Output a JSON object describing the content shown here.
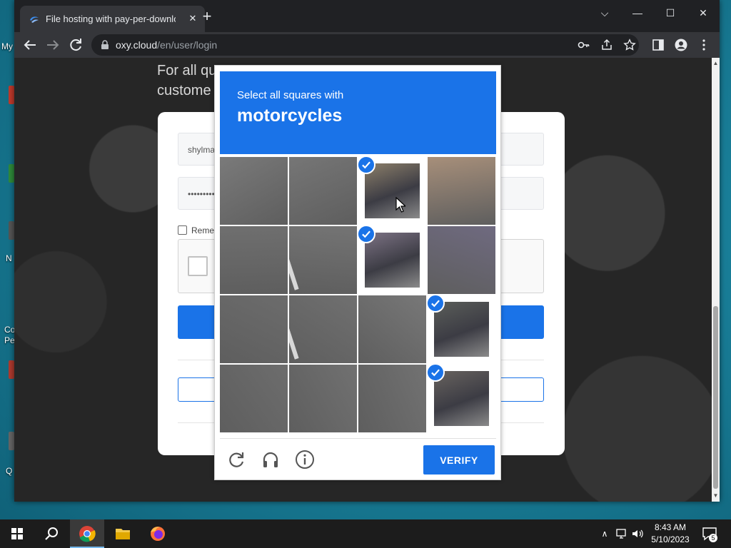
{
  "desktop": {
    "labels": [
      "My",
      "Co",
      "Pe",
      "N",
      "Q"
    ]
  },
  "browser": {
    "tab_title": "File hosting with pay-per-download",
    "tab_close": "✕",
    "new_tab": "+",
    "window_controls": {
      "tabsearch": "⌵",
      "minimize": "—",
      "maximize": "☐",
      "close": "✕"
    },
    "url_host": "oxy.cloud",
    "url_path": "/en/user/login"
  },
  "page": {
    "promo_line1": "For all qu",
    "promo_line2": "custome",
    "username_value": "shylma",
    "password_value": "•••••••••",
    "remember_label": "Reme"
  },
  "captcha": {
    "instruction": "Select all squares with",
    "target": "motorcycles",
    "verify_label": "VERIFY",
    "tiles": [
      {
        "selected": false
      },
      {
        "selected": false
      },
      {
        "selected": true
      },
      {
        "selected": false
      },
      {
        "selected": false
      },
      {
        "selected": false
      },
      {
        "selected": true
      },
      {
        "selected": false
      },
      {
        "selected": false
      },
      {
        "selected": false
      },
      {
        "selected": false
      },
      {
        "selected": true
      },
      {
        "selected": false
      },
      {
        "selected": false
      },
      {
        "selected": false
      },
      {
        "selected": true
      }
    ]
  },
  "taskbar": {
    "time": "8:43 AM",
    "date": "5/10/2023",
    "notification_count": "5"
  },
  "colors": {
    "accent": "#1a73e8",
    "chrome_dark": "#202124",
    "chrome_toolbar": "#35363a"
  },
  "icons": [
    "windows-start-icon",
    "search-icon",
    "chrome-icon",
    "file-explorer-icon",
    "firefox-icon",
    "reload-icon",
    "audio-icon",
    "info-icon",
    "key-icon",
    "share-icon",
    "star-icon",
    "sidepanel-icon",
    "profile-icon",
    "menu-icon"
  ]
}
